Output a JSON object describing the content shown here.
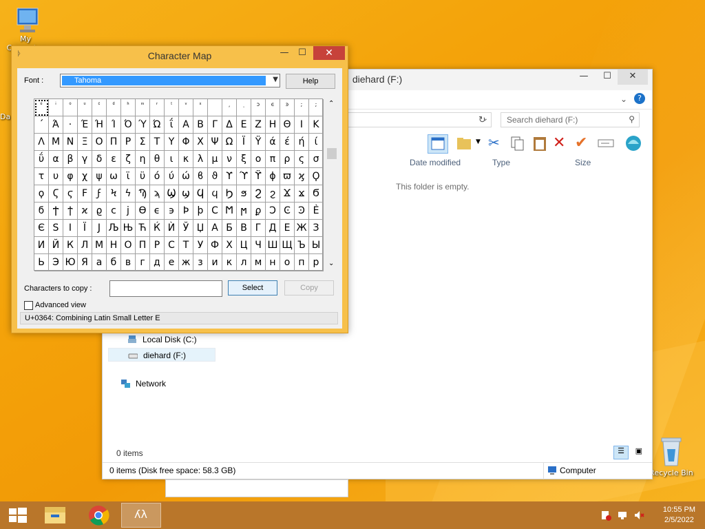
{
  "desktop": {
    "icons": [
      {
        "label": "My Computer"
      },
      {
        "label": "Da"
      },
      {
        "label": "Recycle Bin"
      }
    ]
  },
  "explorer": {
    "title": "diehard (F:)",
    "search_placeholder": "Search diehard (F:)",
    "columns": [
      "Date modified",
      "Type",
      "Size"
    ],
    "empty_message": "This folder is empty.",
    "nav_items": [
      {
        "label": "Local Disk (C:)"
      },
      {
        "label": "diehard (F:)"
      },
      {
        "label": "Network"
      }
    ],
    "item_count": "0 items",
    "details_status": "0 items (Disk free space: 58.3 GB)",
    "details_location": "Computer"
  },
  "charmap": {
    "title": "Character Map",
    "font_label": "Font :",
    "font_value": "Tahoma",
    "help_label": "Help",
    "copy_label": "Characters to copy :",
    "copy_value": "",
    "select_label": "Select",
    "copy_button_label": "Copy",
    "advanced_label": "Advanced view",
    "status_text": "U+0364: Combining Latin Small Letter E",
    "rows": [
      [
        "ͤ",
        "ͥ",
        "ͦ",
        "ͧ",
        "ͨ",
        "ͩ",
        "ͪ",
        "ͫ",
        "ͬ",
        "ͭ",
        "ͮ",
        "ͯ",
        "",
        "͵",
        "ͺ",
        "ͻ",
        "ͼ",
        "ͽ",
        ";",
        ";"
      ],
      [
        "΄",
        "Ά",
        "·",
        "Έ",
        "Ή",
        "Ί",
        "Ό",
        "Ύ",
        "Ώ",
        "ΐ",
        "Α",
        "Β",
        "Γ",
        "Δ",
        "Ε",
        "Ζ",
        "Η",
        "Θ",
        "Ι",
        "Κ"
      ],
      [
        "Λ",
        "Μ",
        "Ν",
        "Ξ",
        "Ο",
        "Π",
        "Ρ",
        "Σ",
        "Τ",
        "Υ",
        "Φ",
        "Χ",
        "Ψ",
        "Ω",
        "Ϊ",
        "Ϋ",
        "ά",
        "έ",
        "ή",
        "ί"
      ],
      [
        "ΰ",
        "α",
        "β",
        "γ",
        "δ",
        "ε",
        "ζ",
        "η",
        "θ",
        "ι",
        "κ",
        "λ",
        "μ",
        "ν",
        "ξ",
        "ο",
        "π",
        "ρ",
        "ς",
        "σ"
      ],
      [
        "τ",
        "υ",
        "φ",
        "χ",
        "ψ",
        "ω",
        "ϊ",
        "ϋ",
        "ό",
        "ύ",
        "ώ",
        "ϐ",
        "ϑ",
        "ϒ",
        "ϓ",
        "ϔ",
        "ϕ",
        "ϖ",
        "ϗ",
        "Ϙ"
      ],
      [
        "ϙ",
        "Ϛ",
        "ϛ",
        "Ϝ",
        "ϝ",
        "Ϟ",
        "ϟ",
        "Ϡ",
        "ϡ",
        "Ϣ",
        "ϣ",
        "Ϥ",
        "ϥ",
        "Ϧ",
        "ϧ",
        "Ϩ",
        "ϩ",
        "Ϫ",
        "ϫ",
        "Ϭ"
      ],
      [
        "ϭ",
        "Ϯ",
        "ϯ",
        "ϰ",
        "ϱ",
        "ϲ",
        "ϳ",
        "ϴ",
        "ϵ",
        "϶",
        "Ϸ",
        "ϸ",
        "Ϲ",
        "Ϻ",
        "ϻ",
        "ϼ",
        "Ͻ",
        "Ͼ",
        "Ͽ",
        "Ѐ"
      ],
      [
        "Є",
        "Ѕ",
        "І",
        "Ї",
        "Ј",
        "Љ",
        "Њ",
        "Ћ",
        "Ќ",
        "Ѝ",
        "Ў",
        "Џ",
        "А",
        "Б",
        "В",
        "Г",
        "Д",
        "Е",
        "Ж",
        "З"
      ],
      [
        "И",
        "Й",
        "К",
        "Л",
        "М",
        "Н",
        "О",
        "П",
        "Р",
        "С",
        "Т",
        "У",
        "Ф",
        "Х",
        "Ц",
        "Ч",
        "Ш",
        "Щ",
        "Ъ",
        "Ы"
      ],
      [
        "Ь",
        "Э",
        "Ю",
        "Я",
        "а",
        "б",
        "в",
        "г",
        "д",
        "е",
        "ж",
        "з",
        "и",
        "к",
        "л",
        "м",
        "н",
        "о",
        "п",
        "р"
      ]
    ]
  },
  "taskbar": {
    "time": "10:55 PM",
    "date": "2/5/2022"
  }
}
